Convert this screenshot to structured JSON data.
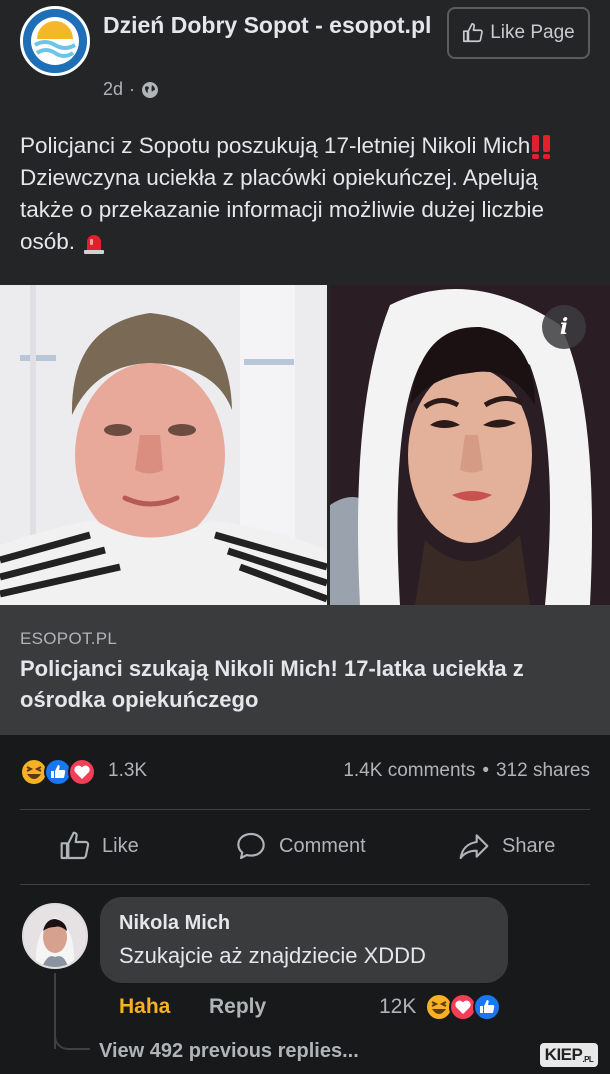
{
  "page": {
    "name": "Dzień Dobry Sopot - esopot.pl",
    "age": "2d",
    "like_page_label": "Like Page"
  },
  "post": {
    "text_part1": "Policjanci z Sopotu poszukują 17-letniej Nikoli Mich",
    "text_part2": " Dziewczyna uciekła z placówki opiekuńczej. Apelują także o przekazanie informacji możliwie dużej liczbie osób. ",
    "emoji_1": "double-exclamation-icon",
    "emoji_2": "police-light-icon"
  },
  "link_preview": {
    "domain": "ESOPOT.PL",
    "title": "Policjanci szukają Nikoli Mich! 17-latka uciekła z ośrodka opiekuńczego"
  },
  "stats": {
    "reactions": [
      "haha",
      "like",
      "love"
    ],
    "reaction_count": "1.3K",
    "comments": "1.4K comments",
    "separator": "•",
    "shares": "312 shares"
  },
  "actions": {
    "like": "Like",
    "comment": "Comment",
    "share": "Share"
  },
  "comment": {
    "author": "Nikola Mich",
    "text": "Szukajcie aż znajdziecie XDDD",
    "reaction_label": "Haha",
    "reply_label": "Reply",
    "reaction_count": "12K",
    "reactions": [
      "haha",
      "love",
      "like"
    ]
  },
  "replies": {
    "view_label": "View 492 previous replies..."
  },
  "watermark": {
    "text": "KIEP",
    "suffix": ".PL"
  },
  "colors": {
    "background": "#18191a",
    "card": "#242526",
    "bubble": "#3a3b3c",
    "text_primary": "#e4e6eb",
    "text_secondary": "#b0b3b8",
    "haha_color": "#f7b125",
    "like_blue": "#1877f2",
    "love_red": "#f33e58"
  }
}
